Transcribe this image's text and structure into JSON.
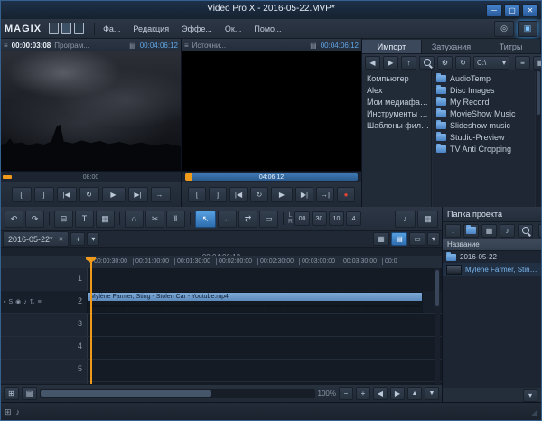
{
  "colors": {
    "accent": "#3d8edb",
    "orange": "#f09a1c",
    "clip_blue": "#6e9ecf",
    "record_red": "#e04338"
  },
  "window": {
    "title": "Video Pro X - 2016-05-22.MVP*",
    "logo": "MAGIX"
  },
  "menubar": {
    "items": [
      "Фа...",
      "Редакция",
      "Эффе...",
      "Ок...",
      "Помо..."
    ]
  },
  "monitors": {
    "program": {
      "timecode": "00:00:03:08",
      "label": "Програм...",
      "duration": "00:04:06:12",
      "ruler_label": "08:00"
    },
    "source": {
      "label": "Источни...",
      "duration": "00:04:06:12",
      "scrub_label": "04:06:12"
    },
    "transport": [
      "[",
      "]",
      "|◀",
      "↻",
      "▶",
      "▶|",
      "→|"
    ]
  },
  "import_panel": {
    "tabs": [
      "Импорт",
      "Затухания",
      "Титры"
    ],
    "path": "C:\\",
    "tree": [
      "Компьютер",
      "Alex",
      "Мои медиафайлы",
      "Инструменты MAGIX",
      "Шаблоны фильмов"
    ],
    "folders": [
      "AudioTemp",
      "Disc Images",
      "My Record",
      "MovieShow Music",
      "Slideshow music",
      "Studio-Preview",
      "TV Anti Cropping"
    ]
  },
  "project_panel": {
    "title": "Папка проекта",
    "name_column": "Название",
    "items": [
      {
        "name": "2016-05-22"
      },
      {
        "name": "Mylène Farmer, Sting - S..."
      }
    ]
  },
  "timeline": {
    "tab": "2016-05-22*",
    "timecode": "00:04:06:12",
    "ruler": [
      "00:00:30:00",
      "00:01:00:00",
      "00:01:30:00",
      "00:02:00:00",
      "00:02:30:00",
      "00:03:00:00",
      "00:03:30:00",
      "00:0"
    ],
    "tracks": [
      "1",
      "2",
      "3",
      "4",
      "5"
    ],
    "clip_name": "Mylène Farmer, Sting - Stolen Car - Youtube.mp4",
    "zoom": "100%",
    "spin_values": [
      "00",
      "30",
      "10",
      "4"
    ]
  },
  "icons": {
    "minimize": "─",
    "maximize": "▢",
    "close": "✕",
    "menu": "≡",
    "grid": "▤",
    "undo": "↶",
    "redo": "↷",
    "trash": "⊟",
    "title_tool": "T",
    "chart": "▦",
    "magnet": "∩",
    "scissors": "✂",
    "split": "‖",
    "cursor": "↖",
    "range": "↔",
    "swap": "⇄",
    "object": "▭",
    "speaker": "♪",
    "record": "●",
    "back": "◀",
    "forward": "▶",
    "up": "↑",
    "gear": "⚙",
    "refresh": "↻",
    "list": "≡",
    "tiles": "▦",
    "dropdown": "▾",
    "plus": "+",
    "close_small": "✕",
    "minus": "−",
    "left": "◀",
    "right": "▶",
    "tri_up": "▲",
    "tri_down": "▼",
    "import": "↓",
    "note": "♪",
    "film": "▦",
    "menu_grid": "⊞",
    "burn": "◎",
    "online": "▣",
    "grip": "◢",
    "l": "L",
    "r": "R",
    "track_lock": "▪",
    "track_solo": "S",
    "track_eye": "◉",
    "track_audio": "♪",
    "track_height": "⇅",
    "track_menu": "≡"
  }
}
